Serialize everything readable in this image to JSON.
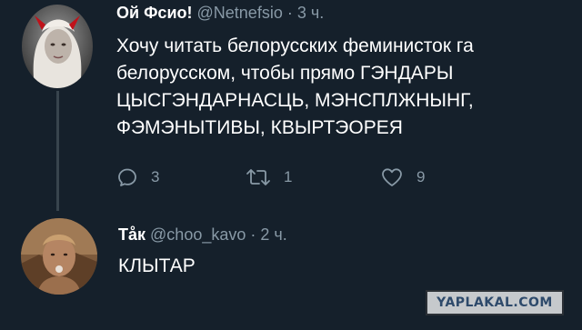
{
  "tweets": [
    {
      "name": "Ой Фсио!",
      "handle": "@Netnefsio",
      "separator": "·",
      "time": "3 ч.",
      "text_lines": [
        "Хочу читать белорусских феминисток га",
        "белорусском, чтобы прямо ГЭНДАРЫ",
        "ЦЫСГЭНДАРНАСЦЬ, МЭНСПЛЖНЫНГ,",
        "ФЭМЭНЫТИВЫ, КВЫРТЭОРЕЯ"
      ],
      "reply_count": "3",
      "retweet_count": "1",
      "like_count": "9"
    },
    {
      "name": "Тåк",
      "handle": "@choo_kavo",
      "separator": "·",
      "time": "2 ч.",
      "text": "КЛЫТАР"
    }
  ],
  "watermark": "YAPLAKAL.COM",
  "colors": {
    "background": "#15202b",
    "secondary_text": "#8899a6",
    "thread_line": "#38444d"
  },
  "icons": [
    "reply-icon",
    "retweet-icon",
    "like-icon"
  ]
}
